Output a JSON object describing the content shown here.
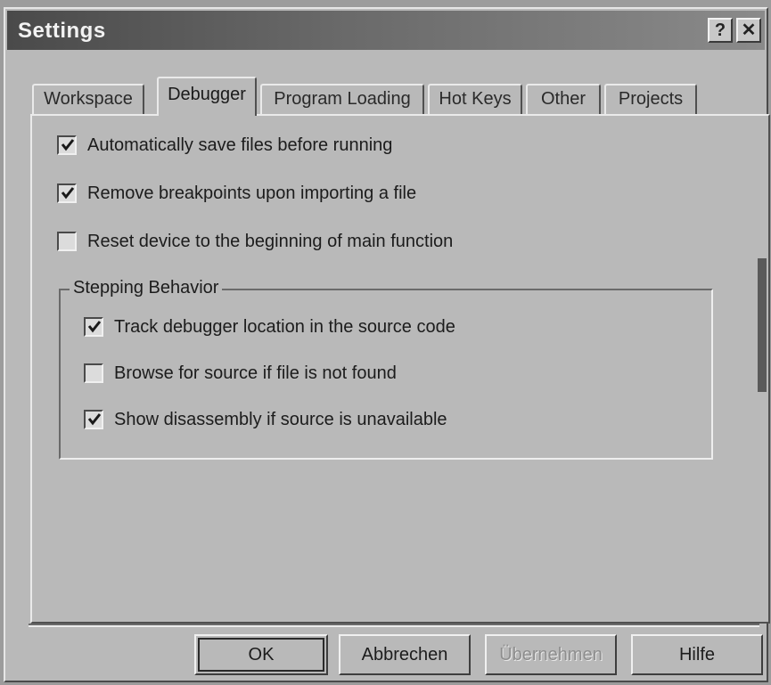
{
  "window": {
    "title": "Settings",
    "help_button": "?",
    "close_button": "✕"
  },
  "tabs": [
    {
      "label": "Workspace",
      "active": false
    },
    {
      "label": "Debugger",
      "active": true
    },
    {
      "label": "Program Loading",
      "active": false
    },
    {
      "label": "Hot Keys",
      "active": false
    },
    {
      "label": "Other",
      "active": false
    },
    {
      "label": "Projects",
      "active": false
    }
  ],
  "options": [
    {
      "label": "Automatically save files before running",
      "checked": true
    },
    {
      "label": "Remove breakpoints upon importing a file",
      "checked": true
    },
    {
      "label": "Reset device to the beginning of main function",
      "checked": false
    }
  ],
  "stepping": {
    "title": "Stepping Behavior",
    "options": [
      {
        "label": "Track debugger location in the source code",
        "checked": true
      },
      {
        "label": "Browse for source if file is not found",
        "checked": false
      },
      {
        "label": "Show disassembly if source is unavailable",
        "checked": true
      }
    ]
  },
  "buttons": {
    "ok": "OK",
    "cancel": "Abbrechen",
    "apply": "Übernehmen",
    "help": "Hilfe"
  }
}
